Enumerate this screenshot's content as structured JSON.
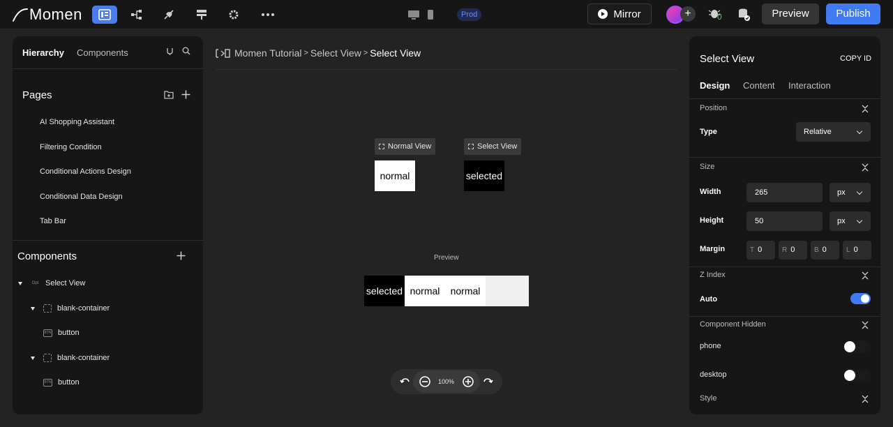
{
  "app": {
    "brand": "Momen"
  },
  "topbar": {
    "env_badge": "Prod",
    "mirror_label": "Mirror",
    "add_collaborator": "+",
    "preview_label": "Preview",
    "publish_label": "Publish",
    "notification_count": "0",
    "icons": [
      "editor-icon",
      "workflow-icon",
      "plugin-icon",
      "data-icon",
      "settings-icon",
      "more-icon",
      "desktop-icon",
      "mobile-icon",
      "bug-icon",
      "database-icon"
    ]
  },
  "left_panel": {
    "tabs": [
      "Hierarchy",
      "Components"
    ],
    "pages_title": "Pages",
    "pages": [
      "AI Shopping Assistant",
      "Filtering Condition",
      "Conditional Actions Design",
      "Conditional Data Design",
      "Tab Bar"
    ],
    "components_title": "Components",
    "add_icon": "+",
    "tree": [
      {
        "label": "Select View",
        "icon": "Opt"
      },
      {
        "label": "blank-container",
        "icon": ""
      },
      {
        "label": "button",
        "icon": "BTN"
      },
      {
        "label": "blank-container",
        "icon": ""
      },
      {
        "label": "button",
        "icon": "BTN"
      }
    ]
  },
  "canvas": {
    "breadcrumb": {
      "icon": "[|]>[]",
      "items": [
        "Momen Tutorial",
        "Select View",
        "Select View"
      ],
      "separator": ">"
    },
    "normal_view_chip": "Normal View",
    "select_view_chip": "Select View",
    "normal_box": "normal",
    "selected_box": "selected",
    "preview_label": "Preview",
    "preview_cells": [
      "selected",
      "normal",
      "normal"
    ],
    "zoom": "100%"
  },
  "right_panel": {
    "title": "Select View",
    "copy_id": "COPY ID",
    "tabs": [
      "Design",
      "Content",
      "Interaction"
    ],
    "position": {
      "section": "Position",
      "type_label": "Type",
      "type_value": "Relative"
    },
    "size": {
      "section": "Size",
      "width_label": "Width",
      "width_value": "265",
      "width_unit": "px",
      "height_label": "Height",
      "height_value": "50",
      "height_unit": "px",
      "margin_label": "Margin",
      "margins": [
        {
          "side": "T",
          "value": "0"
        },
        {
          "side": "R",
          "value": "0"
        },
        {
          "side": "B",
          "value": "0"
        },
        {
          "side": "L",
          "value": "0"
        }
      ]
    },
    "z_index": {
      "section": "Z Index",
      "auto_label": "Auto",
      "auto_on": true
    },
    "hidden": {
      "section": "Component Hidden",
      "phone_label": "phone",
      "desktop_label": "desktop"
    },
    "style": {
      "section": "Style"
    }
  },
  "colors": {
    "accent": "#3f7cf3",
    "background": "#232323",
    "panel": "#161616"
  }
}
